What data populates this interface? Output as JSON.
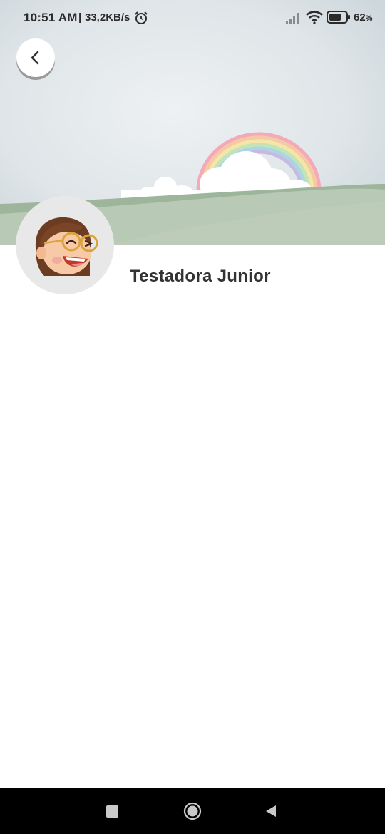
{
  "status_bar": {
    "time": "10:51 AM",
    "separator": "|",
    "network_speed": "33,2KB/s",
    "battery_percent": "62",
    "battery_unit": "%",
    "icons": [
      "alarm-icon",
      "signal-icon",
      "wifi-icon",
      "battery-icon"
    ]
  },
  "header": {
    "back_icon": "chevron-left-icon"
  },
  "profile": {
    "name": "Testadora Junior",
    "avatar": "girl-with-glasses-avatar"
  },
  "nav_bar": {
    "icons": [
      "recent-apps-icon",
      "home-icon",
      "back-triangle-icon"
    ]
  },
  "colors": {
    "sky": "#dfe5e8",
    "hills": "#b8c9b5",
    "hill_dark": "#8fa98b",
    "name_text": "#333333",
    "nav_bar": "#000000"
  }
}
